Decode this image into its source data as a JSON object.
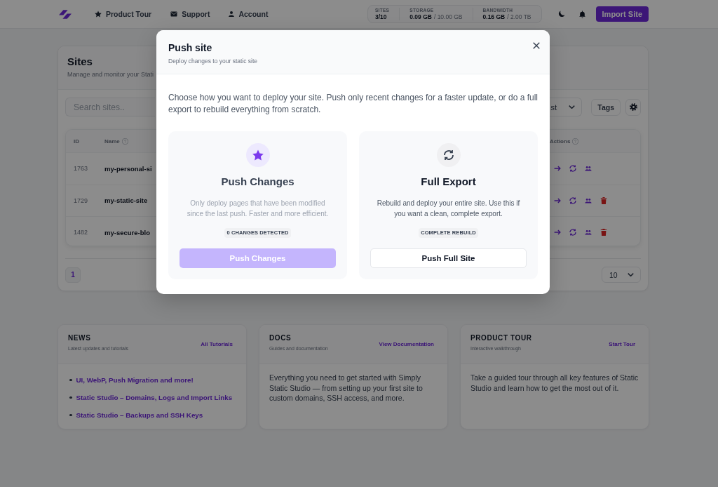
{
  "nav": {
    "links": [
      {
        "label": "Product Tour",
        "kind": "tour"
      },
      {
        "label": "Support",
        "kind": "support"
      },
      {
        "label": "Account",
        "kind": "account"
      }
    ],
    "stats": [
      {
        "label": "SITES",
        "value": "3/10"
      },
      {
        "label": "STORAGE",
        "value": "0.09 GB",
        "limit": "/ 10.00 GB"
      },
      {
        "label": "BANDWIDTH",
        "value": "0.16 GB",
        "limit": "/ 2.00 TB"
      }
    ],
    "import_button": "Import Site"
  },
  "sites": {
    "title": "Sites",
    "subtitle": "Manage and monitor your Stati",
    "search": {
      "placeholder": "Search sites.."
    },
    "sort_select": {
      "value": "st"
    },
    "tags_button": "Tags",
    "table": {
      "columns": [
        {
          "label": "ID",
          "help": false
        },
        {
          "label": "Name",
          "help": true
        },
        {
          "label": "Actions",
          "help": true
        }
      ],
      "rows": [
        {
          "id": "1763",
          "name": "my-personal-si",
          "deletable": false
        },
        {
          "id": "1729",
          "name": "my-static-site",
          "deletable": true
        },
        {
          "id": "1482",
          "name": "my-secure-blo",
          "deletable": true
        }
      ]
    },
    "pagination": {
      "pages": [
        {
          "label": "1",
          "selected": true
        }
      ],
      "per_page": "10"
    }
  },
  "cards": [
    {
      "kind": "list",
      "title": "NEWS",
      "subtitle": "Latest updates and tutorials",
      "link": "All Tutorials",
      "items": [
        "UI, WebP, Push Migration and more!",
        "Static Studio – Domains, Logs and Import Links",
        "Static Studio – Backups and SSH Keys"
      ]
    },
    {
      "kind": "text",
      "title": "DOCS",
      "subtitle": "Guides and documentation",
      "link": "View Documentation",
      "body": "Everything you need to get started with Simply Static Studio — from setting up your first site to custom domains, SSH access, and more."
    },
    {
      "kind": "text",
      "title": "PRODUCT TOUR",
      "subtitle": "Interactive walkthrough",
      "link": "Start Tour",
      "body": "Take a guided tour through all key features of Static Studio and learn how to get the most out of it."
    }
  ],
  "modal": {
    "title": "Push site",
    "subtitle": "Deploy changes to your static site",
    "intro": "Choose how you want to deploy your site. Push only recent changes for a faster update, or do a full export to rebuild everything from scratch.",
    "options": [
      {
        "kind": "incremental",
        "title": "Push Changes",
        "description": "Only deploy pages that have been modified since the last push. Faster and more efficient.",
        "badge": "0 CHANGES DETECTED",
        "button": "Push Changes",
        "disabled": true
      },
      {
        "kind": "full",
        "title": "Full Export",
        "description": "Rebuild and deploy your entire site. Use this if you want a clean, complete export.",
        "badge": "COMPLETE REBUILD",
        "button": "Push Full Site",
        "disabled": false
      }
    ]
  }
}
